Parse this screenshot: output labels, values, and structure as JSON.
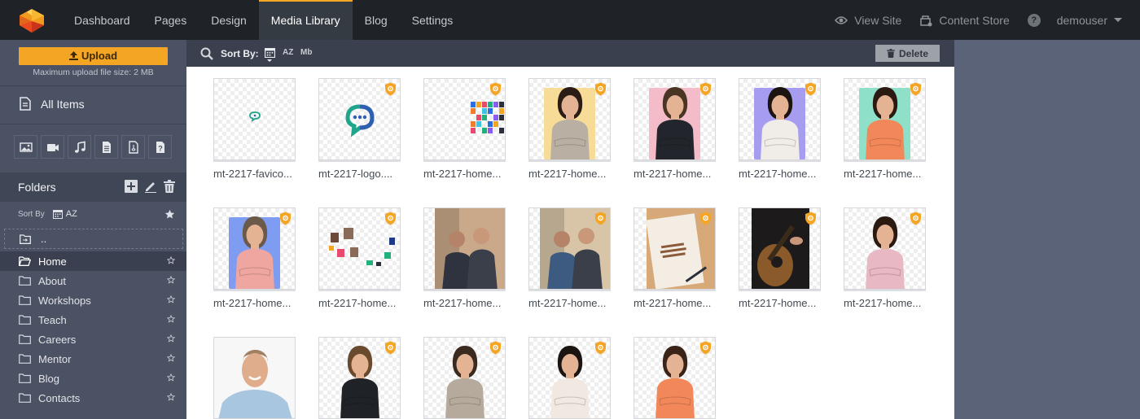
{
  "topnav": {
    "items": [
      "Dashboard",
      "Pages",
      "Design",
      "Media Library",
      "Blog",
      "Settings"
    ],
    "active_index": 3,
    "view_site": "View Site",
    "content_store": "Content Store",
    "help": "?",
    "user": "demouser"
  },
  "sidebar": {
    "upload_label": "Upload",
    "upload_note": "Maximum upload file size: 2 MB",
    "all_items": "All Items",
    "type_filters": [
      "image-icon",
      "video-icon",
      "music-icon",
      "document-icon",
      "pdf-icon",
      "unknown-file-icon"
    ],
    "folders_title": "Folders",
    "sort_by_label": "Sort By",
    "sort_az": "AZ",
    "updir_label": "..",
    "folders": [
      "Home",
      "About",
      "Workshops",
      "Teach",
      "Careers",
      "Mentor",
      "Blog",
      "Contacts"
    ],
    "active_folder": "Home"
  },
  "toolbar": {
    "sort_by": "Sort By:",
    "sort_az": "AZ",
    "sort_mb": "Mb",
    "delete_label": "Delete"
  },
  "colors": {
    "accent": "#f5a524",
    "nav_bg": "#1f2328",
    "sidebar_bg": "#4b5263",
    "page_bg": "#5b6378"
  },
  "media": [
    {
      "caption": "mt-2217-favico...",
      "kind": "favicon",
      "badge": false
    },
    {
      "caption": "mt-2217-logo....",
      "kind": "logo",
      "badge": true
    },
    {
      "caption": "mt-2217-home...",
      "kind": "mosaic",
      "badge": true
    },
    {
      "caption": "mt-2217-home...",
      "kind": "portrait",
      "bg": "#f7dc98",
      "shirt": "#b9b0a3",
      "hair": "#2b1d16",
      "badge": true
    },
    {
      "caption": "mt-2217-home...",
      "kind": "portrait",
      "bg": "#f3bcc8",
      "shirt": "#22262c",
      "hair": "#4a3524",
      "badge": true
    },
    {
      "caption": "mt-2217-home...",
      "kind": "portrait",
      "bg": "#a79df0",
      "shirt": "#f0ece8",
      "hair": "#1b1410",
      "badge": true
    },
    {
      "caption": "mt-2217-home...",
      "kind": "portrait",
      "bg": "#8fe0c8",
      "shirt": "#f2885a",
      "hair": "#2a1a12",
      "badge": true
    },
    {
      "caption": "mt-2217-home...",
      "kind": "portrait",
      "bg": "#7e9cf2",
      "shirt": "#f0a6a0",
      "hair": "#6b5a4a",
      "badge": true
    },
    {
      "caption": "mt-2217-home...",
      "kind": "collage",
      "badge": true
    },
    {
      "caption": "mt-2217-home...",
      "kind": "photo",
      "tone": "#c9a98a",
      "accent": "#2f3340",
      "badge": false
    },
    {
      "caption": "mt-2217-home...",
      "kind": "photo",
      "tone": "#d8c5a8",
      "accent": "#3d5a80",
      "badge": true
    },
    {
      "caption": "mt-2217-home...",
      "kind": "book",
      "badge": true
    },
    {
      "caption": "mt-2217-home...",
      "kind": "guitar",
      "badge": true
    },
    {
      "caption": "mt-2217-home...",
      "kind": "cutout",
      "shirt": "#e8b8c4",
      "hair": "#2a1a12",
      "badge": true
    },
    {
      "caption": "",
      "kind": "headshot",
      "badge": false
    },
    {
      "caption": "",
      "kind": "cutout",
      "shirt": "#1f2328",
      "hair": "#6a4a2e",
      "badge": true
    },
    {
      "caption": "",
      "kind": "cutout",
      "shirt": "#b5aa9c",
      "hair": "#3a2a20",
      "badge": true
    },
    {
      "caption": "",
      "kind": "cutout",
      "shirt": "#f2e8e2",
      "hair": "#1b1410",
      "badge": true
    },
    {
      "caption": "",
      "kind": "cutout",
      "shirt": "#f2885a",
      "hair": "#3a2418",
      "badge": true
    }
  ]
}
